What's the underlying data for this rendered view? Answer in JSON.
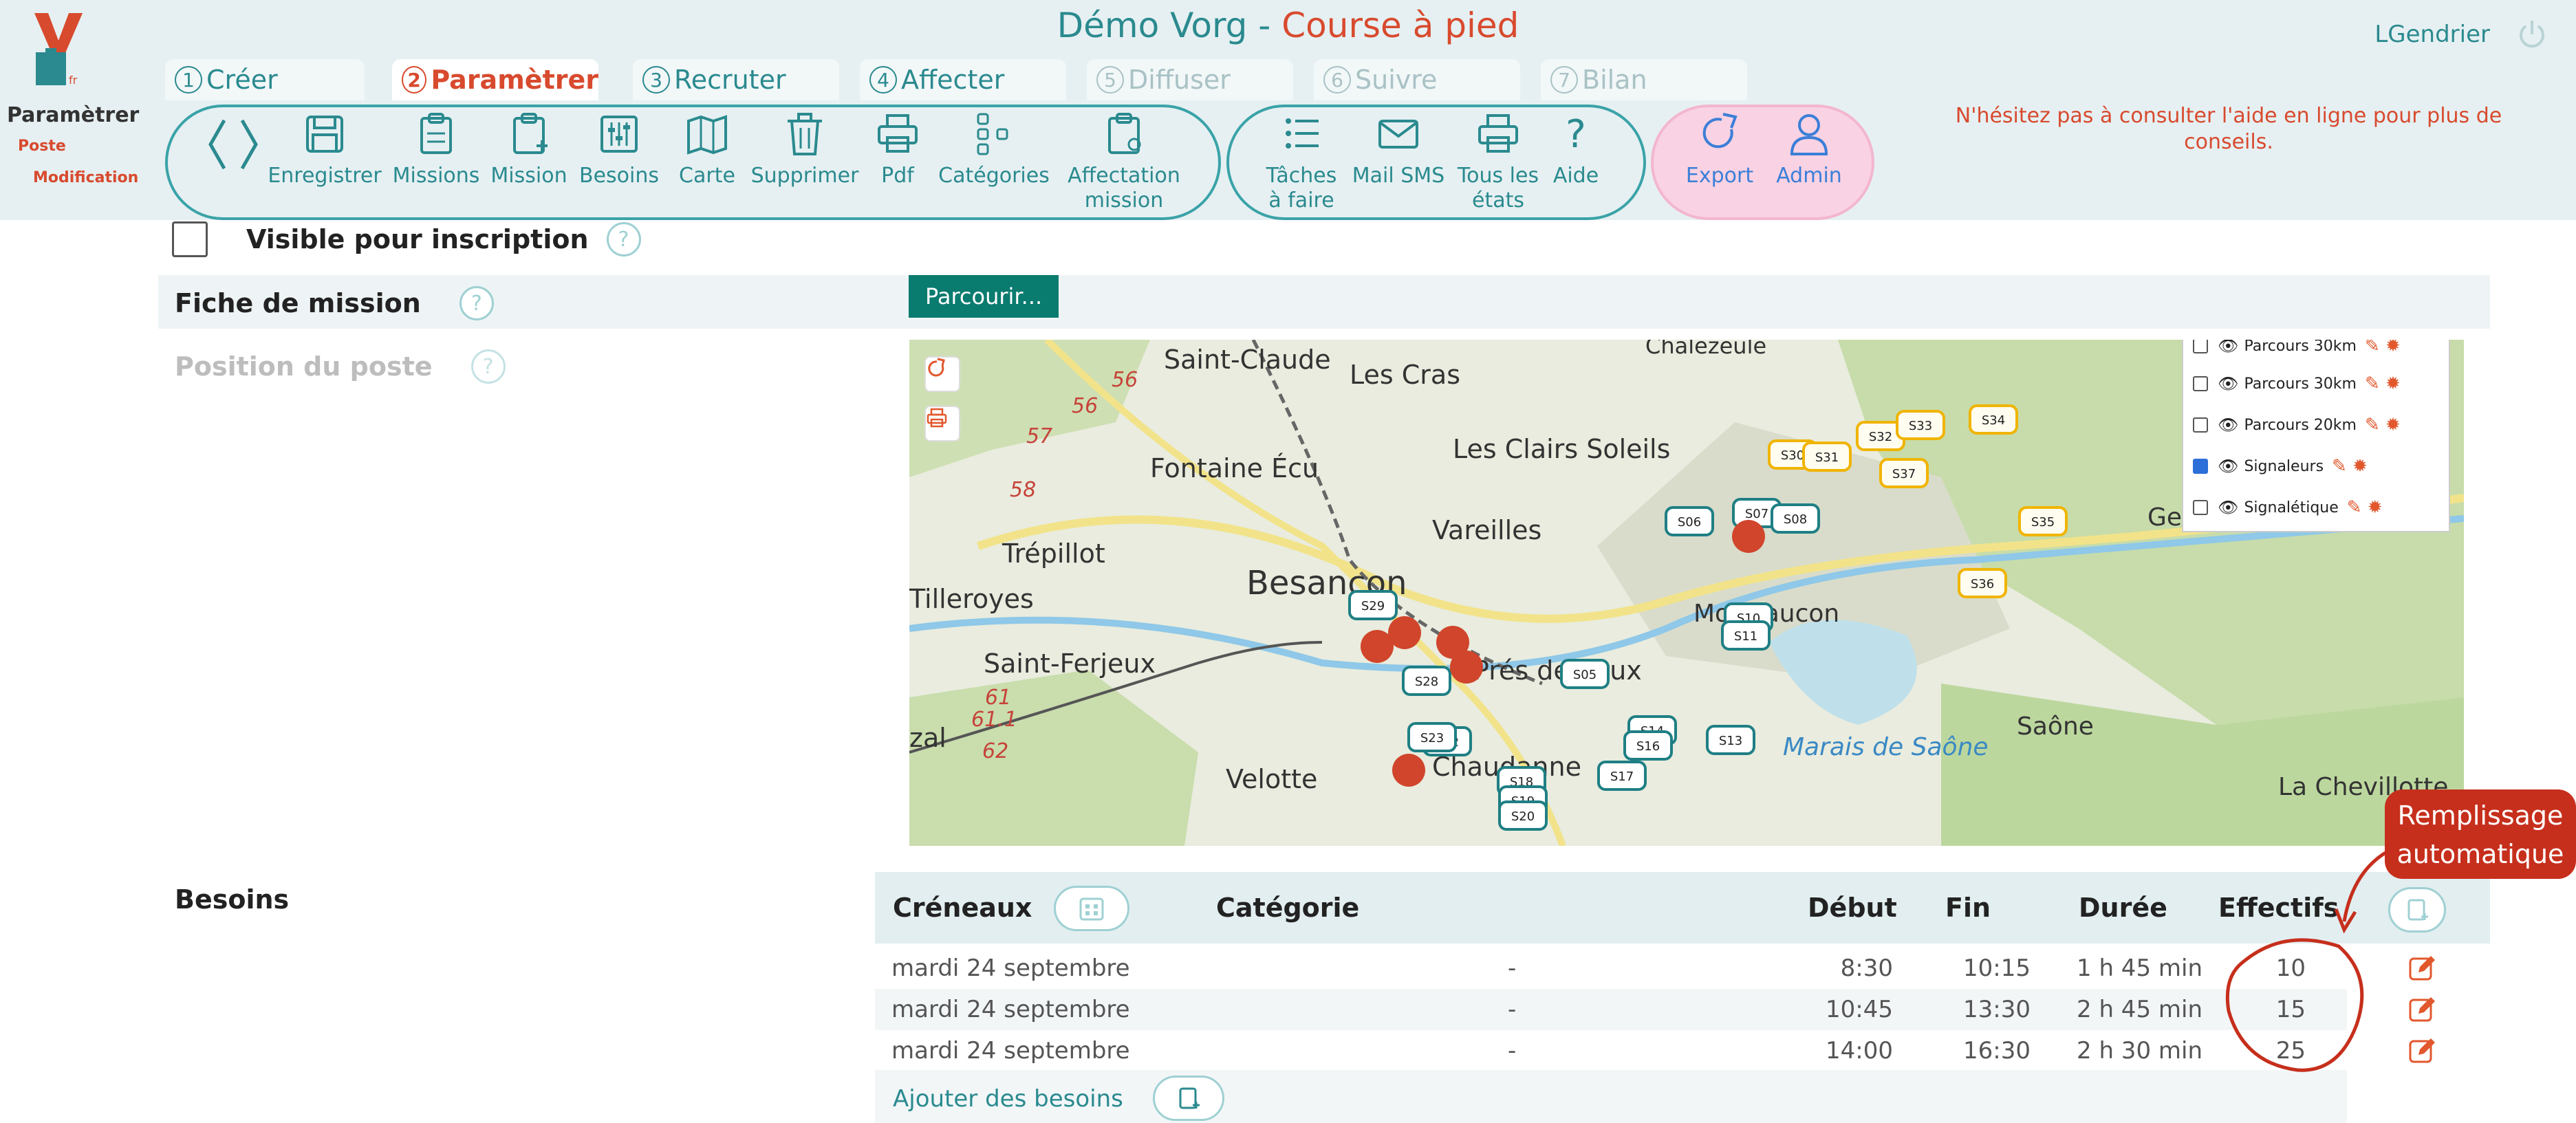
{
  "header": {
    "title": "Démo Vorg",
    "title_sep": " - ",
    "subtitle": "Course à pied",
    "user": "LGendrier",
    "steps": [
      {
        "num": "1",
        "label": "Créer",
        "state": "normal"
      },
      {
        "num": "2",
        "label": "Paramètrer",
        "state": "active"
      },
      {
        "num": "3",
        "label": "Recruter",
        "state": "normal"
      },
      {
        "num": "4",
        "label": "Affecter",
        "state": "normal"
      },
      {
        "num": "5",
        "label": "Diffuser",
        "state": "disabled"
      },
      {
        "num": "6",
        "label": "Suivre",
        "state": "disabled"
      },
      {
        "num": "7",
        "label": "Bilan",
        "state": "disabled"
      }
    ]
  },
  "breadcrumb": {
    "level1": "Paramètrer",
    "level2": "Poste",
    "level3": "Modification"
  },
  "toolbar": {
    "group1": [
      "Enregistrer",
      "Missions",
      "Mission",
      "Besoins",
      "Carte",
      "Supprimer",
      "Pdf",
      "Catégories",
      "Affectation\nmission"
    ],
    "group2": [
      "Tâches\nà faire",
      "Mail SMS",
      "Tous les\nétats",
      "Aide"
    ],
    "group3": [
      "Export",
      "Admin"
    ],
    "help_text": "N'hésitez pas à consulter l'aide en ligne pour plus de conseils."
  },
  "form": {
    "visible_label": "Visible pour inscription",
    "fiche_label": "Fiche de mission",
    "browse_label": "Parcourir...",
    "position_label": "Position du poste",
    "help_glyph": "?"
  },
  "map": {
    "places": [
      "Chalezeule",
      "Saint-Claude",
      "Les Cras",
      "Les Clairs Soleils",
      "Fontaine Écu",
      "Vareilles",
      "Trépillot",
      "Besançon",
      "Tilleroyes",
      "Saint-Ferjeux",
      "Prés de Vaux",
      "Montfaucon",
      "Gennes",
      "Marais de Saône",
      "Saône",
      "La Chevillotte",
      "Velotte",
      "Chaudanne",
      "zal"
    ],
    "km_marks": [
      "56",
      "56",
      "57",
      "58",
      "61",
      "61.1",
      "62"
    ],
    "markers_yellow": [
      "S30",
      "S31",
      "S32",
      "S33",
      "S34",
      "S35",
      "S36",
      "S37"
    ],
    "markers_teal": [
      "S29",
      "S06",
      "S07",
      "S08",
      "S10",
      "S11",
      "S05",
      "S14",
      "S16",
      "S13",
      "S17",
      "S22",
      "S23",
      "S18",
      "S19",
      "S20",
      "S28"
    ],
    "layers": [
      {
        "label": "Parcours 30km",
        "checked": false
      },
      {
        "label": "Parcours 30km",
        "checked": false
      },
      {
        "label": "Parcours 20km",
        "checked": false
      },
      {
        "label": "Signaleurs",
        "checked": true
      },
      {
        "label": "Signalétique",
        "checked": false
      }
    ]
  },
  "besoins": {
    "label": "Besoins",
    "columns": {
      "creneaux": "Créneaux",
      "categorie": "Catégorie",
      "debut": "Début",
      "fin": "Fin",
      "duree": "Durée",
      "effectifs": "Effectifs"
    },
    "rows": [
      {
        "date": "mardi 24 septembre",
        "categorie": "-",
        "debut": "8:30",
        "fin": "10:15",
        "duree": "1 h 45 min",
        "effectifs": "10"
      },
      {
        "date": "mardi 24 septembre",
        "categorie": "-",
        "debut": "10:45",
        "fin": "13:30",
        "duree": "2 h 45 min",
        "effectifs": "15"
      },
      {
        "date": "mardi 24 septembre",
        "categorie": "-",
        "debut": "14:00",
        "fin": "16:30",
        "duree": "2 h 30 min",
        "effectifs": "25"
      }
    ],
    "add_label": "Ajouter des besoins"
  },
  "annotation": {
    "line1": "Remplissage",
    "line2": "automatique"
  },
  "colors": {
    "teal": "#2a8a8f",
    "accent": "#d84a2e",
    "header_bg": "#e6f0f2",
    "admin_pill": "#f9d2e3",
    "annotation": "#c62f1c"
  }
}
